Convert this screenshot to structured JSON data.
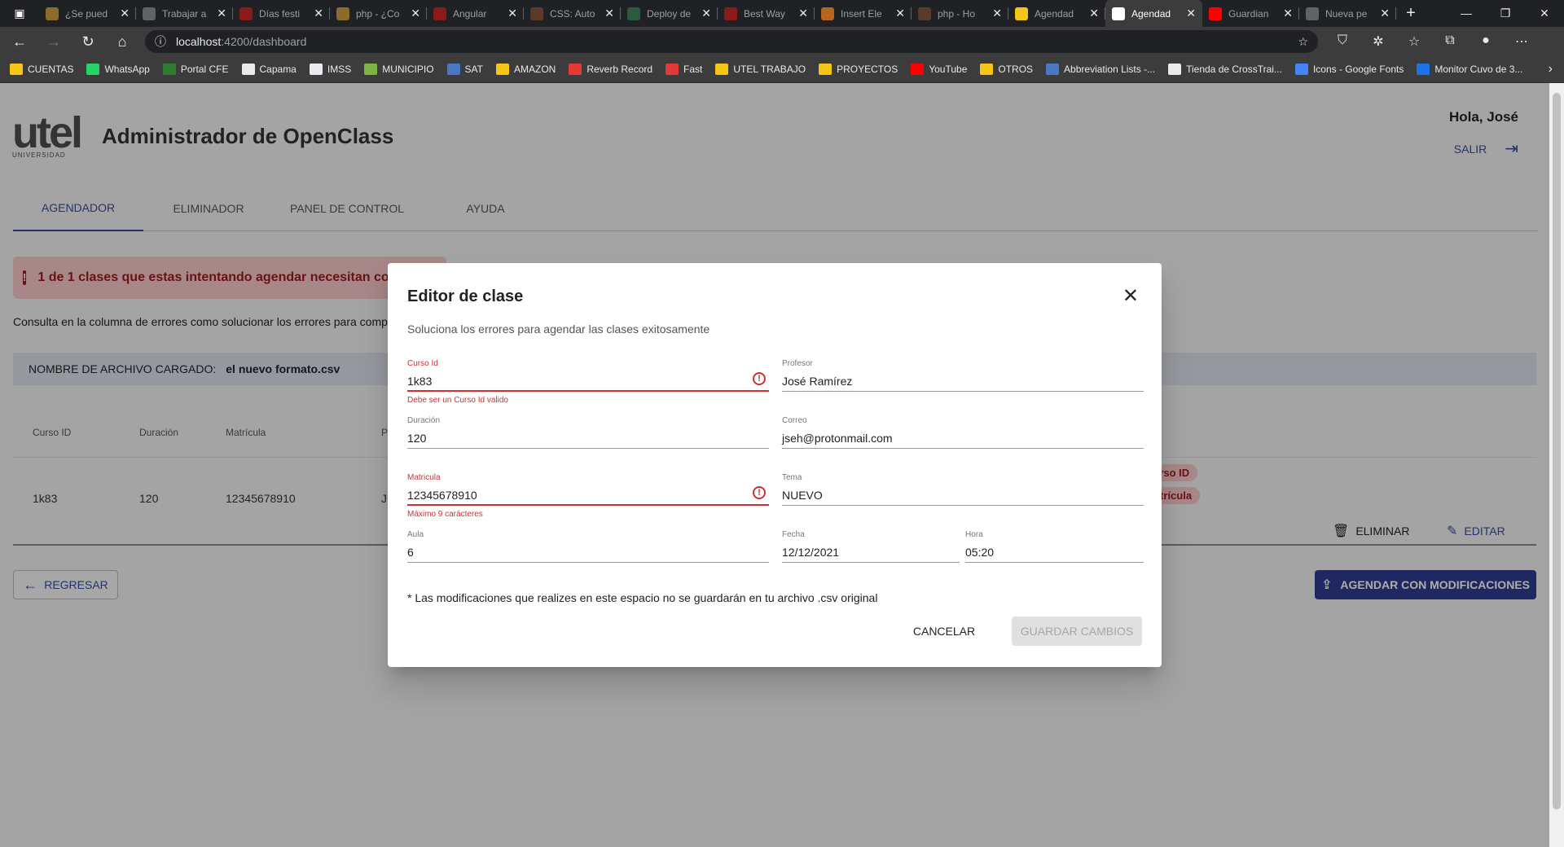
{
  "browser": {
    "tabs": [
      {
        "title": "¿Se pued",
        "color": "#8a6d2b"
      },
      {
        "title": "Trabajar a",
        "color": "#5f6368"
      },
      {
        "title": "Días festi",
        "color": "#8b1a1a"
      },
      {
        "title": "php - ¿Co",
        "color": "#8a6d2b"
      },
      {
        "title": "Angular",
        "color": "#8b1a1a"
      },
      {
        "title": "CSS: Auto",
        "color": "#5a3b2a"
      },
      {
        "title": "Deploy de",
        "color": "#2d5a3d"
      },
      {
        "title": "Best Way",
        "color": "#8b1a1a"
      },
      {
        "title": "Insert Ele",
        "color": "#b5651d"
      },
      {
        "title": "php - Ho",
        "color": "#5a3b2a"
      },
      {
        "title": "Agendad",
        "color": "#f5c518"
      },
      {
        "title": "Agendad",
        "color": "#ffffff"
      },
      {
        "title": "Guardian",
        "color": "#ff0000"
      },
      {
        "title": "Nueva pe",
        "color": "#5f6368"
      }
    ],
    "url_host": "localhost",
    "url_path": ":4200/dashboard",
    "bookmarks": [
      {
        "label": "CUENTAS",
        "color": "#f5c518"
      },
      {
        "label": "WhatsApp",
        "color": "#25d366"
      },
      {
        "label": "Portal CFE",
        "color": "#2e7d32"
      },
      {
        "label": "Capama",
        "color": "#e8eaed"
      },
      {
        "label": "IMSS",
        "color": "#e8eaed"
      },
      {
        "label": "MUNICIPIO",
        "color": "#7cb342"
      },
      {
        "label": "SAT",
        "color": "#4a77c4"
      },
      {
        "label": "AMAZON",
        "color": "#f5c518"
      },
      {
        "label": "Reverb Record",
        "color": "#e53935"
      },
      {
        "label": "Fast",
        "color": "#e53935"
      },
      {
        "label": "UTEL TRABAJO",
        "color": "#f5c518"
      },
      {
        "label": "PROYECTOS",
        "color": "#f5c518"
      },
      {
        "label": "YouTube",
        "color": "#ff0000"
      },
      {
        "label": "OTROS",
        "color": "#f5c518"
      },
      {
        "label": "Abbreviation Lists -...",
        "color": "#4a77c4"
      },
      {
        "label": "Tienda de CrossTrai...",
        "color": "#e8eaed"
      },
      {
        "label": "Icons - Google Fonts",
        "color": "#4285f4"
      },
      {
        "label": "Monitor Cuvo de 3...",
        "color": "#1a73e8"
      }
    ]
  },
  "app": {
    "logo_word": "utel",
    "logo_sub": "UNIVERSIDAD",
    "title": "Administrador de OpenClass",
    "greeting": "Hola, José",
    "logout_label": "SALIR",
    "nav_tabs": [
      "AGENDADOR",
      "ELIMINADOR",
      "PANEL DE CONTROL",
      "AYUDA"
    ],
    "alert_text": "1 de 1 clases que estas intentando agendar necesitan correcciones",
    "hint_text": "Consulta en la columna de errores como solucionar los errores para completar el agendado",
    "file_label": "NOMBRE DE ARCHIVO CARGADO:",
    "file_name": "el nuevo formato.csv",
    "table": {
      "headers": [
        "Curso ID",
        "Duración",
        "Matrícula",
        "P"
      ],
      "row": [
        "1k83",
        "120",
        "12345678910",
        "J"
      ],
      "error_chips": [
        "Curso ID",
        "Matrícula"
      ],
      "delete_label": "ELIMINAR",
      "edit_label": "EDITAR"
    },
    "back_label": "REGRESAR",
    "submit_label": "AGENDAR CON MODIFICACIONES"
  },
  "dialog": {
    "title": "Editor de clase",
    "subtitle": "Soluciona los errores para agendar las clases exitosamente",
    "fields": {
      "curso_id": {
        "label": "Curso Id",
        "value": "1k83",
        "error": "Debe ser un Curso Id valido"
      },
      "profesor": {
        "label": "Profesor",
        "value": "José Ramírez"
      },
      "duracion": {
        "label": "Duración",
        "value": "120"
      },
      "correo": {
        "label": "Correo",
        "value": "jseh@protonmail.com"
      },
      "matricula": {
        "label": "Matricula",
        "value": "12345678910",
        "error": "Máximo 9 carácteres"
      },
      "tema": {
        "label": "Tema",
        "value": "NUEVO"
      },
      "aula": {
        "label": "Aula",
        "value": "6"
      },
      "fecha": {
        "label": "Fecha",
        "value": "12/12/2021"
      },
      "hora": {
        "label": "Hora",
        "value": "05:20"
      }
    },
    "note": "* Las modificaciones que realizes en este espacio no se guardarán en tu archivo .csv original",
    "cancel_label": "CANCELAR",
    "save_label": "GUARDAR CAMBIOS"
  }
}
